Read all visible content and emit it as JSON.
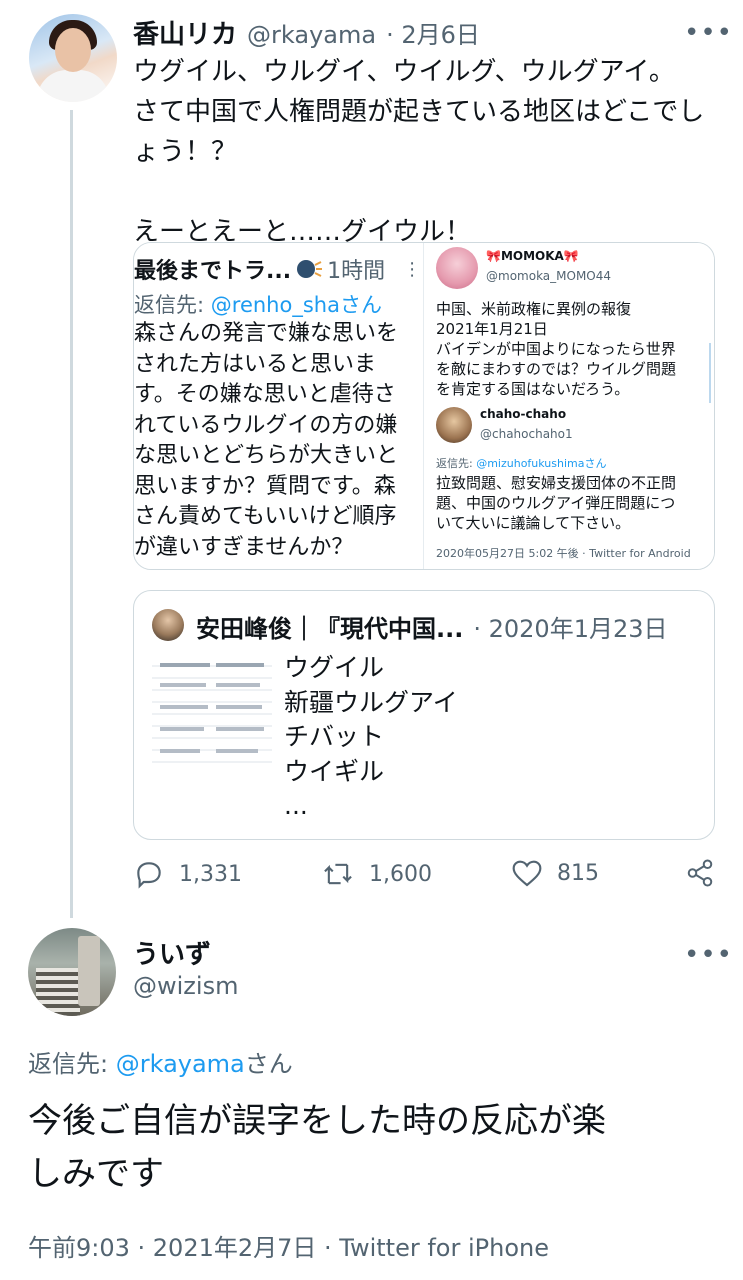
{
  "tweet1": {
    "name": "香山リカ",
    "handle": "@rkayama",
    "date": "· 2月6日",
    "text": "ウグイル、ウルグイ、ウイルグ、ウルグアイ。\nさて中国で人権問題が起きている地区はどこでし\nょう！？\n\nえーとえーと……グイウル！",
    "media": {
      "left": {
        "header_name": "最後までトラ...",
        "header_time": "1時間",
        "reply_to_label": "返信先: ",
        "reply_to_handle": "@renho_sha",
        "reply_to_suffix": "さん",
        "body": "森さんの発言で嫌な思いを\nされた方はいると思いま\nす。その嫌な思いと虐待さ\nれているウルグイの方の嫌\nな思いとどちらが大きいと\n思いますか？質問です。森\nさん責めてもいいけど順序\nが違いすぎませんか？"
      },
      "right": {
        "user1_name": "🎀MOMOKA🎀",
        "user1_handle": "@momoka_MOMO44",
        "user1_text": "中国、米前政権に異例の報復\n2021年1月21日\nバイデンが中国よりになったら世界\nを敵にまわすのでは？ウイルグ問題\nを肯定する国はないだろう。",
        "user2_name": "chaho-chaho",
        "user2_handle": "@chahochaho1",
        "reply_label": "返信先: ",
        "reply_handle": "@mizuhofukushima",
        "reply_suffix": "さん",
        "user2_text": "拉致問題、慰安婦支援団体の不正問\n題、中国のウルグアイ弾圧問題につ\nいて大いに議論して下さい。",
        "footer": "2020年05月27日 5:02 午後 · Twitter for Android"
      }
    },
    "quote": {
      "name": "安田峰俊｜『現代中国...",
      "date": "· 2020年1月23日",
      "text": "ウグイル\n新疆ウルグアイ\nチバット\nウイギル\n..."
    },
    "stats": {
      "replies": "1,331",
      "retweets": "1,600",
      "likes": "815"
    }
  },
  "tweet2": {
    "name": "ういず",
    "handle": "@wizism",
    "reply_label": "返信先: ",
    "reply_handle": "@rkayama",
    "reply_suffix": "さん",
    "text": "今後ご自信が誤字をした時の反応が楽\nしみです",
    "footer": "午前9:03 · 2021年2月7日 · Twitter for iPhone"
  },
  "icons": [
    "more-icon",
    "reply-icon",
    "retweet-icon",
    "like-icon",
    "share-icon",
    "speaking-head-icon",
    "vertical-more-icon"
  ],
  "colors": {
    "link": "#1d9bf0",
    "secondary": "#536471",
    "border": "#cfd9de"
  }
}
